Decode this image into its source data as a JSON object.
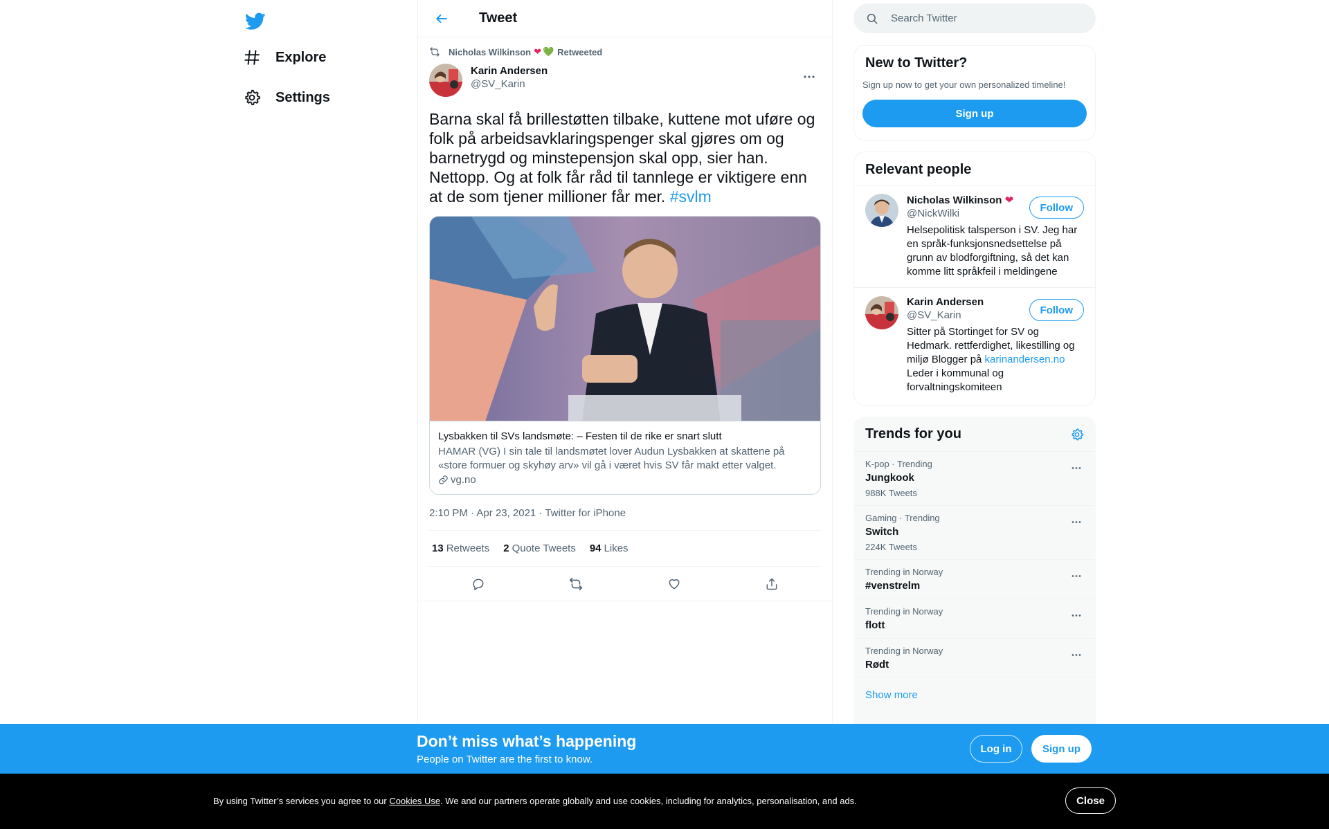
{
  "brand": {
    "accent": "#1d9bf0",
    "logo_icon": "twitter-bird-icon"
  },
  "nav": {
    "items": [
      {
        "label": "Explore",
        "icon": "hashtag-icon"
      },
      {
        "label": "Settings",
        "icon": "gear-icon"
      }
    ]
  },
  "header": {
    "title": "Tweet",
    "back_icon": "arrow-left-icon"
  },
  "tweet": {
    "retweeted_by": "Nicholas Wilkinson",
    "retweeted_label": "Retweeted",
    "author_name": "Karin Andersen",
    "author_handle": "@SV_Karin",
    "text": "Barna skal få brillestøtten tilbake, kuttene mot uføre og folk på arbeidsavklaringspenger skal gjøres om og barnetrygd og minstepensjon skal opp, sier han. Nettopp. Og at folk får råd til tannlege er viktigere enn at de som tjener millioner får mer.",
    "hashtag": "#svlm",
    "card": {
      "title": "Lysbakken til SVs landsmøte: – Festen til de rike er snart slutt",
      "description": "HAMAR (VG) I sin tale til landsmøtet lover Audun Lysbakken at skattene på «store formuer og skyhøy arv» vil gå i været hvis SV får makt etter valget.",
      "domain": "vg.no"
    },
    "meta": "2:10 PM · Apr 23, 2021 · Twitter for iPhone",
    "stats": [
      {
        "count": "13",
        "label": "Retweets"
      },
      {
        "count": "2",
        "label": "Quote Tweets"
      },
      {
        "count": "94",
        "label": "Likes"
      }
    ]
  },
  "search": {
    "placeholder": "Search Twitter"
  },
  "new_to_twitter": {
    "title": "New to Twitter?",
    "subtitle": "Sign up now to get your own personalized timeline!",
    "signup_label": "Sign up"
  },
  "relevant_people": {
    "title": "Relevant people",
    "people": [
      {
        "name": "Nicholas Wilkinson",
        "handle": "@NickWilki",
        "follow_label": "Follow",
        "bio": "Helsepolitisk talsperson i SV. Jeg har en språk-funksjonsnedsettelse på grunn av blodforgiftning, så det kan komme litt språkfeil i meldingene"
      },
      {
        "name": "Karin Andersen",
        "handle": "@SV_Karin",
        "follow_label": "Follow",
        "bio_before": "Sitter på Stortinget for SV og Hedmark. rettferdighet, likestilling og miljø Blogger på ",
        "bio_link": "karinandersen.no",
        "bio_after": " Leder i kommunal og forvaltningskomiteen"
      }
    ]
  },
  "trends": {
    "title": "Trends for you",
    "items": [
      {
        "context": "K-pop · Trending",
        "name": "Jungkook",
        "count": "988K Tweets"
      },
      {
        "context": "Gaming · Trending",
        "name": "Switch",
        "count": "224K Tweets"
      },
      {
        "context": "Trending in Norway",
        "name": "#venstrelm",
        "count": ""
      },
      {
        "context": "Trending in Norway",
        "name": "flott",
        "count": ""
      },
      {
        "context": "Trending in Norway",
        "name": "Rødt",
        "count": ""
      }
    ],
    "show_more": "Show more"
  },
  "bottom_bar": {
    "title": "Don’t miss what’s happening",
    "subtitle": "People on Twitter are the first to know.",
    "login_label": "Log in",
    "signup_label": "Sign up"
  },
  "cookie": {
    "text_before": "By using Twitter’s services you agree to our ",
    "link": "Cookies Use",
    "text_after": ". We and our partners operate globally and use cookies, including for analytics, personalisation, and ads.",
    "close_label": "Close"
  }
}
